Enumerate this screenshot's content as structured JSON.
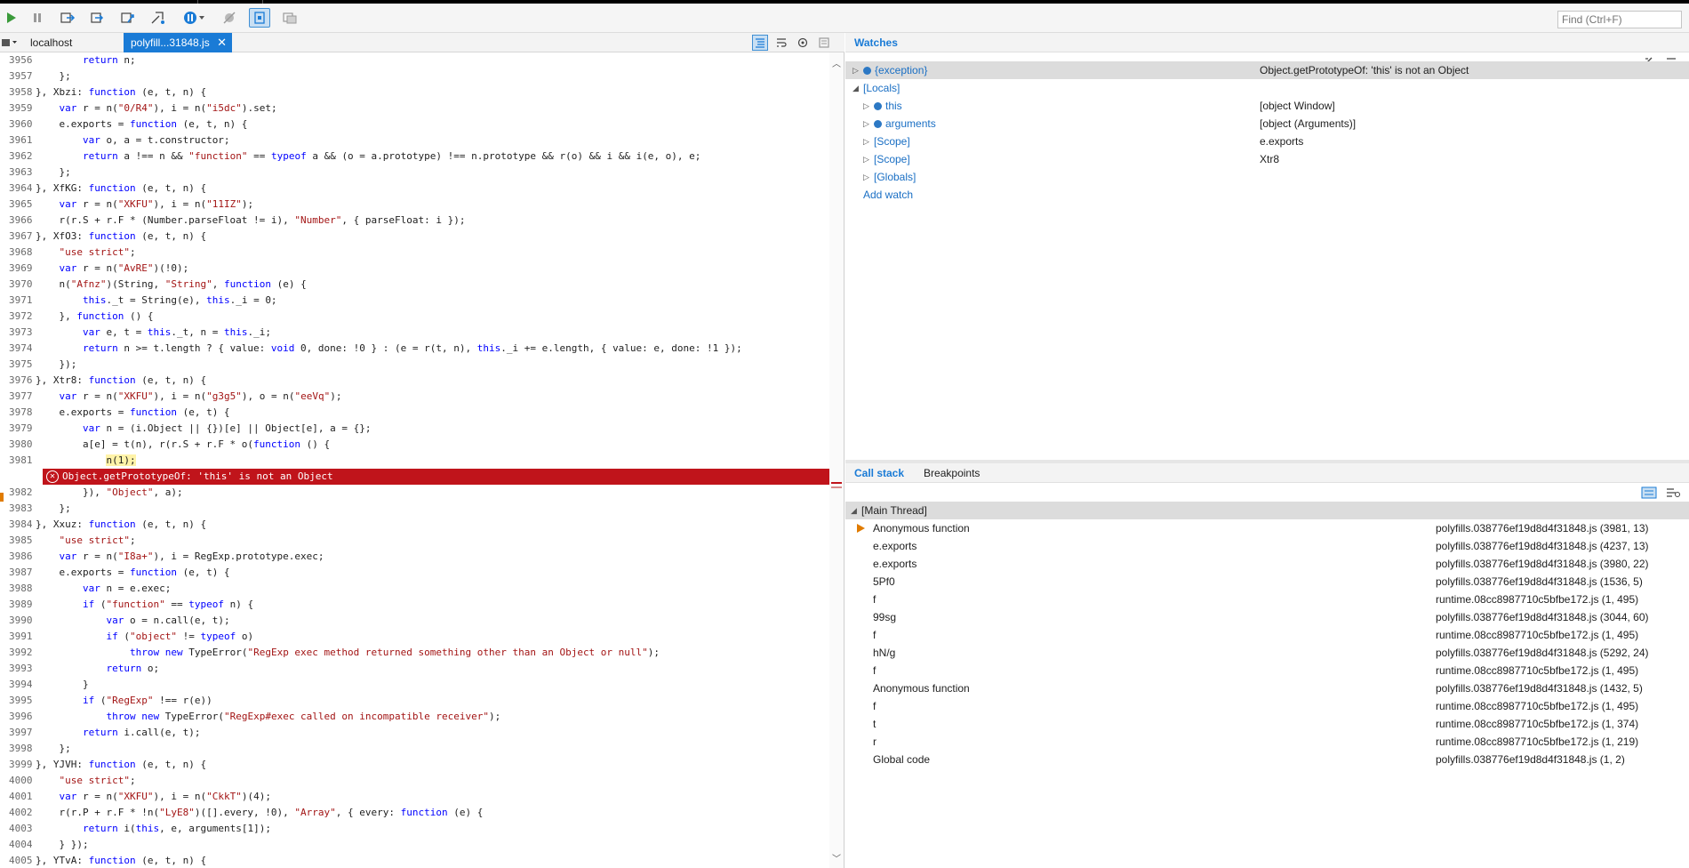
{
  "toolbar": {
    "find_placeholder": "Find (Ctrl+F)"
  },
  "tabs": {
    "localhost": "localhost",
    "active_file": "polyfill...31848.js",
    "close": "✕"
  },
  "code_lines": [
    {
      "n": "3956",
      "t": "        return n;"
    },
    {
      "n": "3957",
      "t": "    };"
    },
    {
      "n": "3958",
      "t": "}, Xbzi: function (e, t, n) {"
    },
    {
      "n": "3959",
      "t": "    var r = n(\"0/R4\"), i = n(\"i5dc\").set;"
    },
    {
      "n": "3960",
      "t": "    e.exports = function (e, t, n) {"
    },
    {
      "n": "3961",
      "t": "        var o, a = t.constructor;"
    },
    {
      "n": "3962",
      "t": "        return a !== n && \"function\" == typeof a && (o = a.prototype) !== n.prototype && r(o) && i && i(e, o), e;"
    },
    {
      "n": "3963",
      "t": "    };"
    },
    {
      "n": "3964",
      "t": "}, XfKG: function (e, t, n) {"
    },
    {
      "n": "3965",
      "t": "    var r = n(\"XKFU\"), i = n(\"11IZ\");"
    },
    {
      "n": "3966",
      "t": "    r(r.S + r.F * (Number.parseFloat != i), \"Number\", { parseFloat: i });"
    },
    {
      "n": "3967",
      "t": "}, XfO3: function (e, t, n) {"
    },
    {
      "n": "3968",
      "t": "    \"use strict\";"
    },
    {
      "n": "3969",
      "t": "    var r = n(\"AvRE\")(!0);"
    },
    {
      "n": "3970",
      "t": "    n(\"Afnz\")(String, \"String\", function (e) {"
    },
    {
      "n": "3971",
      "t": "        this._t = String(e), this._i = 0;"
    },
    {
      "n": "3972",
      "t": "    }, function () {"
    },
    {
      "n": "3973",
      "t": "        var e, t = this._t, n = this._i;"
    },
    {
      "n": "3974",
      "t": "        return n >= t.length ? { value: void 0, done: !0 } : (e = r(t, n), this._i += e.length, { value: e, done: !1 });"
    },
    {
      "n": "3975",
      "t": "    });"
    },
    {
      "n": "3976",
      "t": "}, Xtr8: function (e, t, n) {"
    },
    {
      "n": "3977",
      "t": "    var r = n(\"XKFU\"), i = n(\"g3g5\"), o = n(\"eeVq\");"
    },
    {
      "n": "3978",
      "t": "    e.exports = function (e, t) {"
    },
    {
      "n": "3979",
      "t": "        var n = (i.Object || {})[e] || Object[e], a = {};"
    },
    {
      "n": "3980",
      "t": "        a[e] = t(n), r(r.S + r.F * o(function () {"
    },
    {
      "n": "3981",
      "t": "            n(1);"
    },
    {
      "n": "3982",
      "t": "        }), \"Object\", a);"
    },
    {
      "n": "3983",
      "t": "    };"
    },
    {
      "n": "3984",
      "t": "}, Xxuz: function (e, t, n) {"
    },
    {
      "n": "3985",
      "t": "    \"use strict\";"
    },
    {
      "n": "3986",
      "t": "    var r = n(\"I8a+\"), i = RegExp.prototype.exec;"
    },
    {
      "n": "3987",
      "t": "    e.exports = function (e, t) {"
    },
    {
      "n": "3988",
      "t": "        var n = e.exec;"
    },
    {
      "n": "3989",
      "t": "        if (\"function\" == typeof n) {"
    },
    {
      "n": "3990",
      "t": "            var o = n.call(e, t);"
    },
    {
      "n": "3991",
      "t": "            if (\"object\" != typeof o)"
    },
    {
      "n": "3992",
      "t": "                throw new TypeError(\"RegExp exec method returned something other than an Object or null\");"
    },
    {
      "n": "3993",
      "t": "            return o;"
    },
    {
      "n": "3994",
      "t": "        }"
    },
    {
      "n": "3995",
      "t": "        if (\"RegExp\" !== r(e))"
    },
    {
      "n": "3996",
      "t": "            throw new TypeError(\"RegExp#exec called on incompatible receiver\");"
    },
    {
      "n": "3997",
      "t": "        return i.call(e, t);"
    },
    {
      "n": "3998",
      "t": "    };"
    },
    {
      "n": "3999",
      "t": "}, YJVH: function (e, t, n) {"
    },
    {
      "n": "4000",
      "t": "    \"use strict\";"
    },
    {
      "n": "4001",
      "t": "    var r = n(\"XKFU\"), i = n(\"CkkT\")(4);"
    },
    {
      "n": "4002",
      "t": "    r(r.P + r.F * !n(\"LyE8\")([].every, !0), \"Array\", { every: function (e) {"
    },
    {
      "n": "4003",
      "t": "        return i(this, e, arguments[1]);"
    },
    {
      "n": "4004",
      "t": "    } });"
    },
    {
      "n": "4005",
      "t": "}, YTvA: function (e, t, n) {"
    }
  ],
  "current_line": "3981",
  "error_message": "Object.getPrototypeOf: 'this' is not an Object",
  "watches": {
    "title": "Watches",
    "rows": [
      {
        "name": "{exception}",
        "value": "Object.getPrototypeOf: 'this' is not an Object",
        "indent": 0,
        "icon": true,
        "expand": "collapsed",
        "selected": true
      },
      {
        "name": "[Locals]",
        "value": "",
        "indent": 0,
        "icon": false,
        "expand": "expanded",
        "selected": false
      },
      {
        "name": "this",
        "value": "[object Window]",
        "indent": 1,
        "icon": true,
        "expand": "collapsed",
        "selected": false
      },
      {
        "name": "arguments",
        "value": "[object (Arguments)]",
        "indent": 1,
        "icon": true,
        "expand": "collapsed",
        "selected": false
      },
      {
        "name": "[Scope]",
        "value": "e.exports",
        "indent": 1,
        "icon": false,
        "expand": "collapsed",
        "selected": false
      },
      {
        "name": "[Scope]",
        "value": "Xtr8",
        "indent": 1,
        "icon": false,
        "expand": "collapsed",
        "selected": false
      },
      {
        "name": "[Globals]",
        "value": "",
        "indent": 1,
        "icon": false,
        "expand": "collapsed",
        "selected": false
      }
    ],
    "add_watch": "Add watch"
  },
  "callstack": {
    "tabs": [
      "Call stack",
      "Breakpoints"
    ],
    "thread": "[Main Thread]",
    "frames": [
      {
        "fn": "Anonymous function",
        "loc": "polyfills.038776ef19d8d4f31848.js (3981, 13)",
        "current": true
      },
      {
        "fn": "e.exports",
        "loc": "polyfills.038776ef19d8d4f31848.js (4237, 13)",
        "current": false
      },
      {
        "fn": "e.exports",
        "loc": "polyfills.038776ef19d8d4f31848.js (3980, 22)",
        "current": false
      },
      {
        "fn": "5Pf0",
        "loc": "polyfills.038776ef19d8d4f31848.js (1536, 5)",
        "current": false
      },
      {
        "fn": "f",
        "loc": "runtime.08cc8987710c5bfbe172.js (1, 495)",
        "current": false
      },
      {
        "fn": "99sg",
        "loc": "polyfills.038776ef19d8d4f31848.js (3044, 60)",
        "current": false
      },
      {
        "fn": "f",
        "loc": "runtime.08cc8987710c5bfbe172.js (1, 495)",
        "current": false
      },
      {
        "fn": "hN/g",
        "loc": "polyfills.038776ef19d8d4f31848.js (5292, 24)",
        "current": false
      },
      {
        "fn": "f",
        "loc": "runtime.08cc8987710c5bfbe172.js (1, 495)",
        "current": false
      },
      {
        "fn": "Anonymous function",
        "loc": "polyfills.038776ef19d8d4f31848.js (1432, 5)",
        "current": false
      },
      {
        "fn": "f",
        "loc": "runtime.08cc8987710c5bfbe172.js (1, 495)",
        "current": false
      },
      {
        "fn": "t",
        "loc": "runtime.08cc8987710c5bfbe172.js (1, 374)",
        "current": false
      },
      {
        "fn": "r",
        "loc": "runtime.08cc8987710c5bfbe172.js (1, 219)",
        "current": false
      },
      {
        "fn": "Global code",
        "loc": "polyfills.038776ef19d8d4f31848.js (1, 2)",
        "current": false
      }
    ]
  },
  "colors": {
    "accent": "#1a7bd6",
    "error": "#c0141b",
    "current_frame": "#e07b00",
    "keyword": "#0000ff",
    "string": "#a31515"
  }
}
